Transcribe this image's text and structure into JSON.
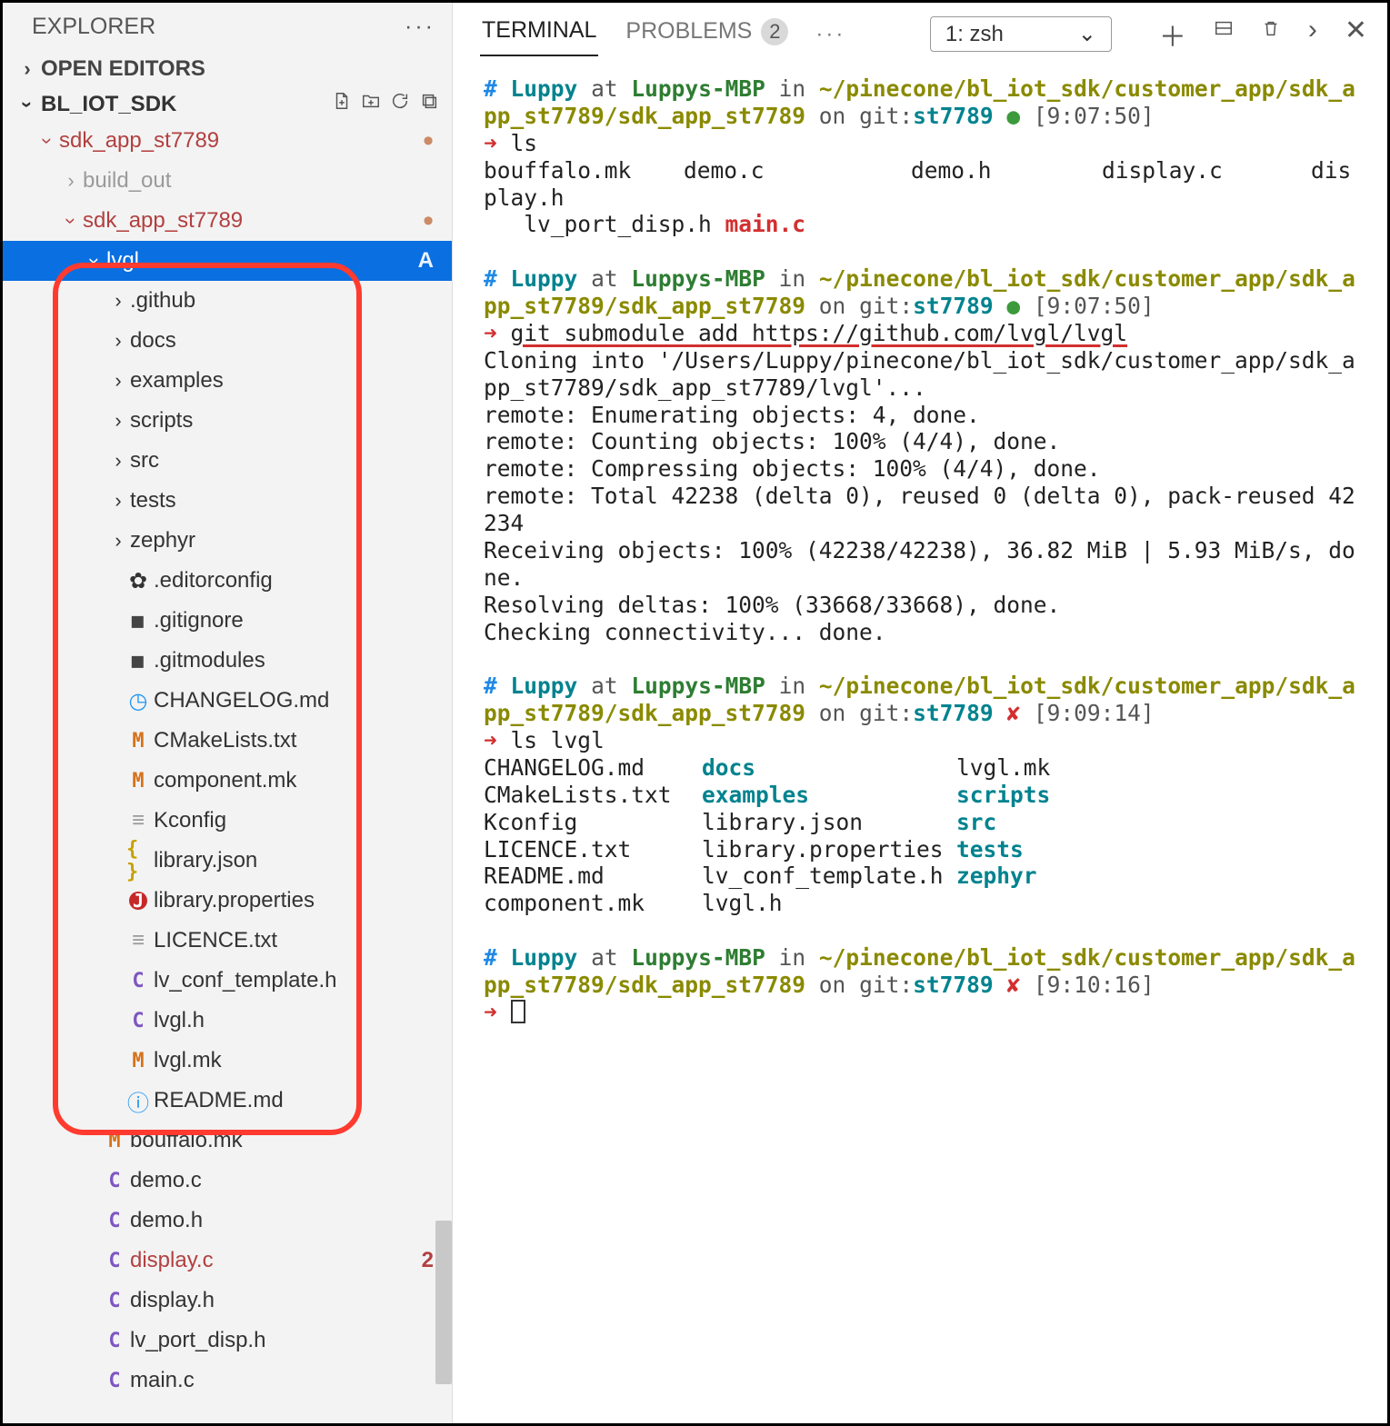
{
  "sidebar": {
    "title": "EXPLORER",
    "open_editors": "OPEN EDITORS",
    "project": "BL_IOT_SDK",
    "tree": [
      {
        "d": 1,
        "t": "folder-open",
        "label": "sdk_app_st7789",
        "mod": true,
        "dot": true
      },
      {
        "d": 2,
        "t": "folder-closed",
        "label": "build_out",
        "dim": true
      },
      {
        "d": 2,
        "t": "folder-open",
        "label": "sdk_app_st7789",
        "mod": true,
        "dot": true
      },
      {
        "d": 3,
        "t": "folder-open",
        "label": "lvgl",
        "selected": true,
        "status": "A"
      },
      {
        "d": 4,
        "t": "folder-closed",
        "label": ".github"
      },
      {
        "d": 4,
        "t": "folder-closed",
        "label": "docs"
      },
      {
        "d": 4,
        "t": "folder-closed",
        "label": "examples"
      },
      {
        "d": 4,
        "t": "folder-closed",
        "label": "scripts"
      },
      {
        "d": 4,
        "t": "folder-closed",
        "label": "src"
      },
      {
        "d": 4,
        "t": "folder-closed",
        "label": "tests"
      },
      {
        "d": 4,
        "t": "folder-closed",
        "label": "zephyr"
      },
      {
        "d": 4,
        "t": "file",
        "icon": "gear",
        "label": ".editorconfig"
      },
      {
        "d": 4,
        "t": "file",
        "icon": "git",
        "label": ".gitignore"
      },
      {
        "d": 4,
        "t": "file",
        "icon": "git",
        "label": ".gitmodules"
      },
      {
        "d": 4,
        "t": "file",
        "icon": "clock",
        "label": "CHANGELOG.md"
      },
      {
        "d": 4,
        "t": "file",
        "icon": "M",
        "label": "CMakeLists.txt"
      },
      {
        "d": 4,
        "t": "file",
        "icon": "M",
        "label": "component.mk"
      },
      {
        "d": 4,
        "t": "file",
        "icon": "lines",
        "label": "Kconfig"
      },
      {
        "d": 4,
        "t": "file",
        "icon": "braces",
        "label": "library.json"
      },
      {
        "d": 4,
        "t": "file",
        "icon": "J",
        "label": "library.properties"
      },
      {
        "d": 4,
        "t": "file",
        "icon": "lines",
        "label": "LICENCE.txt"
      },
      {
        "d": 4,
        "t": "file",
        "icon": "C",
        "label": "lv_conf_template.h"
      },
      {
        "d": 4,
        "t": "file",
        "icon": "C",
        "label": "lvgl.h"
      },
      {
        "d": 4,
        "t": "file",
        "icon": "M",
        "label": "lvgl.mk"
      },
      {
        "d": 4,
        "t": "file",
        "icon": "info",
        "label": "README.md"
      },
      {
        "d": 3,
        "t": "file",
        "icon": "M",
        "label": "bouffalo.mk"
      },
      {
        "d": 3,
        "t": "file",
        "icon": "C",
        "label": "demo.c"
      },
      {
        "d": 3,
        "t": "file",
        "icon": "C",
        "label": "demo.h"
      },
      {
        "d": 3,
        "t": "file",
        "icon": "C",
        "label": "display.c",
        "mod": true,
        "num": "2"
      },
      {
        "d": 3,
        "t": "file",
        "icon": "C",
        "label": "display.h"
      },
      {
        "d": 3,
        "t": "file",
        "icon": "C",
        "label": "lv_port_disp.h"
      },
      {
        "d": 3,
        "t": "file",
        "icon": "C",
        "label": "main.c"
      }
    ]
  },
  "panel": {
    "tab_terminal": "TERMINAL",
    "tab_problems": "PROBLEMS",
    "problems_count": "2",
    "terminal_select": "1: zsh"
  },
  "term": {
    "prompt": {
      "hash": "#",
      "user": "Luppy",
      "at": "at",
      "host": "Luppys-MBP",
      "in": "in",
      "path": "~/pinecone/bl_iot_sdk/customer_app/sdk_app_st7789/sdk_app_st7789",
      "on": "on",
      "git": "git:",
      "branch": "st7789"
    },
    "times": {
      "t1": "[9:07:50]",
      "t2": "[9:07:50]",
      "t3": "[9:09:14]",
      "t4": "[9:10:16]"
    },
    "status": {
      "ok": "●",
      "bad": "✘"
    },
    "arrow": "➜",
    "cmds": {
      "ls": "ls",
      "submodule": "git submodule add https://github.com/lvgl/lvgl",
      "lslvgl": "ls lvgl"
    },
    "ls_out": {
      "l1a": "bouffalo.mk",
      "l1b": "demo.c",
      "l1c": "demo.h",
      "l1d": "display.c",
      "l1e": "display.h",
      "l2a": "lv_port_disp.h",
      "l2b": "main.c"
    },
    "clone": {
      "l1": "Cloning into '/Users/Luppy/pinecone/bl_iot_sdk/customer_app/sdk_app_st7789/sdk_app_st7789/lvgl'...",
      "l2": "remote: Enumerating objects: 4, done.",
      "l3": "remote: Counting objects: 100% (4/4), done.",
      "l4": "remote: Compressing objects: 100% (4/4), done.",
      "l5": "remote: Total 42238 (delta 0), reused 0 (delta 0), pack-reused 42234",
      "l6": "Receiving objects: 100% (42238/42238), 36.82 MiB | 5.93 MiB/s, done.",
      "l7": "Resolving deltas: 100% (33668/33668), done.",
      "l8": "Checking connectivity... done."
    },
    "lvgl_listing": {
      "c1": [
        "CHANGELOG.md",
        "CMakeLists.txt",
        "Kconfig",
        "LICENCE.txt",
        "README.md",
        "component.mk"
      ],
      "c2": [
        "docs",
        "examples",
        "library.json",
        "library.properties",
        "lv_conf_template.h",
        "lvgl.h"
      ],
      "c2dir": [
        true,
        true,
        false,
        false,
        false,
        false
      ],
      "c3": [
        "lvgl.mk",
        "scripts",
        "src",
        "tests",
        "zephyr",
        ""
      ],
      "c3dir": [
        false,
        true,
        true,
        true,
        true,
        false
      ]
    }
  }
}
